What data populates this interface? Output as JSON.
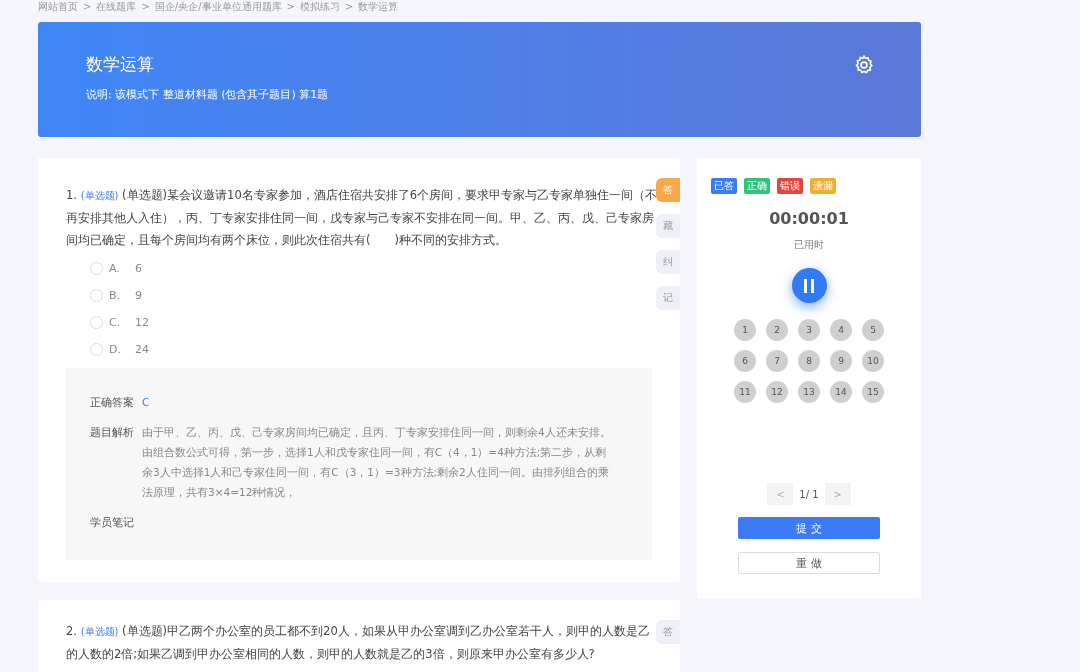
{
  "breadcrumb": [
    "网站首页",
    ">",
    "在线题库",
    ">",
    "国企/央企/事业单位通用题库",
    ">",
    "模拟练习",
    ">",
    "数学运算"
  ],
  "header": {
    "title": "数学运算",
    "description": "说明:  该模式下 整道材料题 (包含其子题目) 算1题"
  },
  "questions": [
    {
      "number": "1.",
      "tag": "(单选题)",
      "text": "(单选题)某会议邀请10名专家参加，酒店住宿共安排了6个房间，要求甲专家与乙专家单独住一间（不再安排其他人入住），丙、丁专家安排住同一间，戊专家与己专家不安排在同一间。甲、乙、丙、戊、己专家房间均已确定，且每个房间均有两个床位，则此次住宿共有(　　)种不同的安排方式。",
      "options": [
        {
          "letter": "A.",
          "text": "6",
          "selected": false
        },
        {
          "letter": "B.",
          "text": "9",
          "selected": false
        },
        {
          "letter": "C.",
          "text": "12",
          "selected": false
        },
        {
          "letter": "D.",
          "text": "24",
          "selected": false
        }
      ],
      "answer": {
        "label": "正确答案",
        "value": "C"
      },
      "analysis": {
        "label": "题目解析",
        "text": "由于甲、乙、丙、戊、己专家房间均已确定，且丙、丁专家安排住同一间，则剩余4人还未安排。由组合数公式可得，第一步，选择1人和戊专家住同一间，有C（4，1）=4种方法;第二步，从剩余3人中选择1人和己专家住同一间，有C（3，1）=3种方法;剩余2人住同一间。由排列组合的乘法原理，共有3×4=12种情况，"
      },
      "notes": {
        "label": "学员笔记"
      },
      "side_tabs": [
        {
          "label": "答",
          "selected": true
        },
        {
          "label": "藏",
          "selected": false
        },
        {
          "label": "纠",
          "selected": false
        },
        {
          "label": "记",
          "selected": false
        }
      ]
    },
    {
      "number": "2.",
      "tag": "(单选题)",
      "text": "(单选题)甲乙两个办公室的员工都不到20人，如果从甲办公室调到乙办公室若干人，则甲的人数是乙的人数的2倍;如果乙调到甲办公室相同的人数，则甲的人数就是乙的3倍，则原来甲办公室有多少人?",
      "side_tabs": [
        {
          "label": "答",
          "selected": false
        }
      ]
    }
  ],
  "panel": {
    "legend": [
      {
        "label": "已答",
        "color": "#3b7cf6"
      },
      {
        "label": "正确",
        "color": "#2fc47f"
      },
      {
        "label": "错误",
        "color": "#e2463c"
      },
      {
        "label": "遗漏",
        "color": "#efb02a"
      }
    ],
    "timer": "00:00:01",
    "timer_label": "已用时",
    "numbers": [
      {
        "label": "1",
        "answered": false
      },
      {
        "label": "2",
        "answered": false
      },
      {
        "label": "3",
        "answered": false
      },
      {
        "label": "4",
        "answered": false
      },
      {
        "label": "5",
        "answered": false
      },
      {
        "label": "6",
        "answered": false
      },
      {
        "label": "7",
        "answered": false
      },
      {
        "label": "8",
        "answered": false
      },
      {
        "label": "9",
        "answered": false
      },
      {
        "label": "10",
        "answered": false
      },
      {
        "label": "11",
        "answered": false
      },
      {
        "label": "12",
        "answered": false
      },
      {
        "label": "13",
        "answered": false
      },
      {
        "label": "14",
        "answered": false
      },
      {
        "label": "15",
        "answered": false
      }
    ],
    "pager": {
      "prev": "<",
      "page": "1/ 1",
      "next": ">"
    },
    "submit": "提 交",
    "redo": "重 做"
  }
}
